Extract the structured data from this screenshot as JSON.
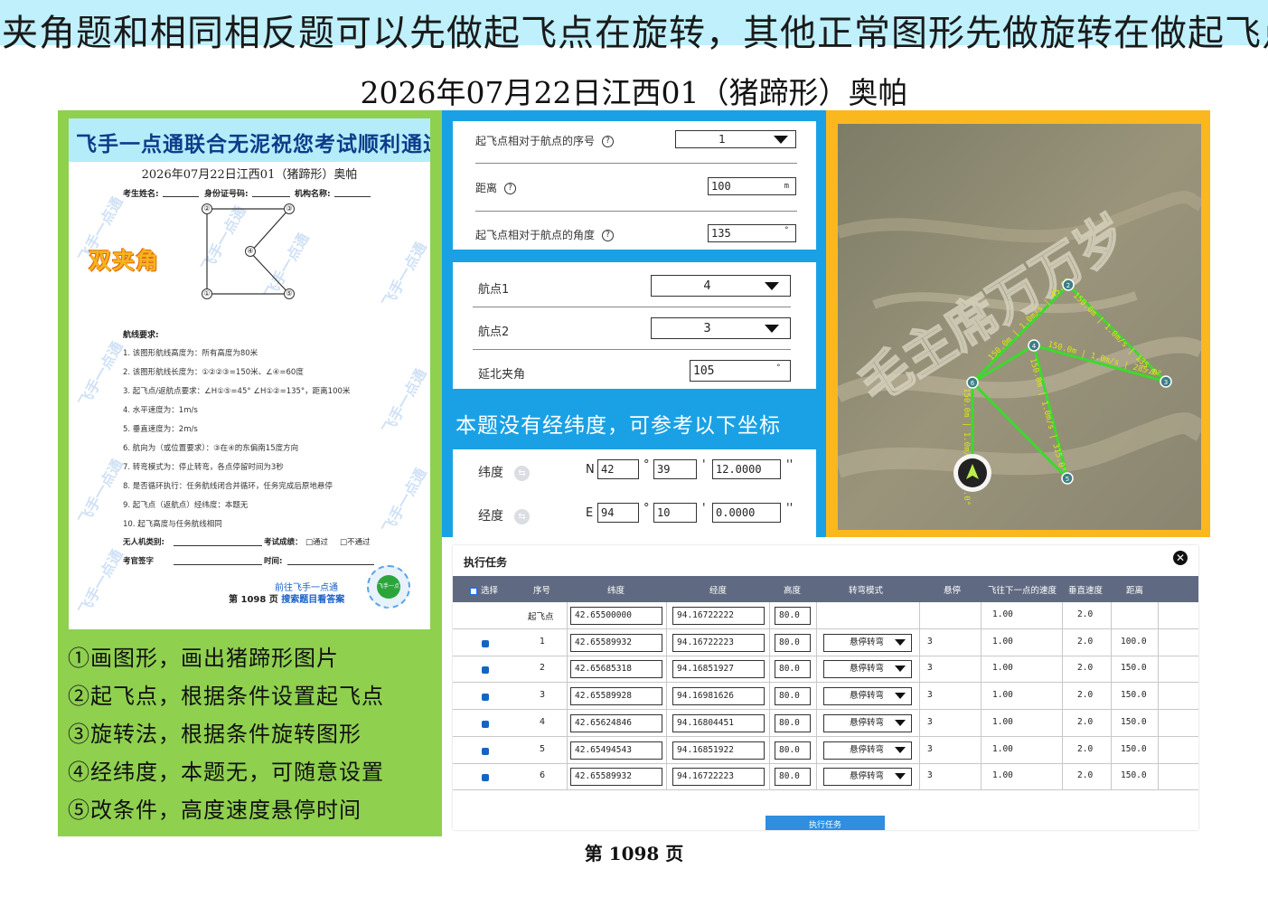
{
  "banner": "夹角题和相同相反题可以先做起飞点在旋转，其他正常图形先做旋转在做起飞点",
  "title": "2026年07月22日江西01（猪蹄形）奥帕",
  "paper": {
    "banner": "飞手一点通联合无泥祝您考试顺利通过",
    "title": "2026年07月22日江西01（猪蹄形）奥帕",
    "fields": [
      "考生姓名:",
      "身份证号码:",
      "机构名称:"
    ],
    "badge": "双夹角",
    "points": [
      "①",
      "②",
      "③",
      "④",
      "⑤"
    ],
    "requirements_head": "航线要求:",
    "requirements": [
      "1.  该图形航线高度为：所有高度为80米",
      "2.  该图形航线长度为：①②②③=150米、∠④=60度",
      "3.  起飞点/返航点要求：∠H①⑤=45°  ∠H①②=135°，距离100米",
      "4.  水平速度为：1m/s",
      "5.  垂直速度为：2m/s",
      "6.  航向为（或位置要求）：③在④的东偏南15度方向",
      "7.  转弯模式为：停止转弯，各点停留时间为3秒",
      "8.  是否循环执行：任务航线闭合并循环，任务完成后原地悬停",
      "9.  起飞点（返航点）经纬度：本题无",
      "10. 起飞高度与任务航线相同"
    ],
    "uav_type": "无人机类别:",
    "result": "考试成绩：",
    "pass": "□通过",
    "fail": "□不通过",
    "examiner": "考官签字",
    "time": "时间:",
    "foot1": "前往飞手一点通",
    "foot2_a": "第  1098  页",
    "foot2_b": "搜索题目看答案",
    "qr_text": "飞手一点通",
    "watermark": "飞手一点通"
  },
  "steps": [
    "①画图形，画出猪蹄形图片",
    "②起飞点，根据条件设置起飞点",
    "③旋转法，根据条件旋转图形",
    "④经纬度，本题无，可随意设置",
    "⑤改条件，高度速度悬停时间"
  ],
  "takeoff_form": {
    "seq_label": "起飞点相对于航点的序号",
    "seq_value": "1",
    "dist_label": "距离",
    "dist_value": "100",
    "dist_unit": "m",
    "angle_label": "起飞点相对于航点的角度",
    "angle_value": "135",
    "angle_unit": "°",
    "help": "?"
  },
  "angle_form": {
    "wp1_label": "航点1",
    "wp1_value": "4",
    "wp2_label": "航点2",
    "wp2_value": "3",
    "ext_label": "延北夹角",
    "ext_value": "105",
    "ext_unit": "°"
  },
  "ref_text": "本题没有经纬度，可参考以下坐标",
  "coords": {
    "lat_label": "纬度",
    "lat_dir": "N",
    "lat_deg": "42",
    "lat_min": "39",
    "lat_sec": "12.0000",
    "lon_label": "经度",
    "lon_dir": "E",
    "lon_deg": "94",
    "lon_min": "10",
    "lon_sec": "0.0000",
    "deg_sym": "°",
    "min_sym": "'",
    "sec_sym": "''"
  },
  "map": {
    "ground_text": "毛主席万万岁",
    "labels": [
      "150.0m | 1.0m/s | 45.0°",
      "150.0m | 1.0m/s | 135.0°",
      "150.0m | 1.0m/s | 315.0°",
      "150.0m | 1.0m/s | 225.0°",
      "150.0m | 1.0m/s | 285.0°"
    ],
    "wp_ids": [
      "2",
      "3",
      "4",
      "5",
      "6"
    ]
  },
  "task": {
    "title": "执行任务",
    "close": "✕",
    "headers": {
      "select": "选择",
      "seq": "序号",
      "lat": "纬度",
      "lon": "经度",
      "alt": "高度",
      "turn": "转弯模式",
      "hover": "悬停",
      "hspeed": "飞往下一点的速度",
      "vspeed": "垂直速度",
      "dist": "距离"
    },
    "rows": [
      {
        "seq": "起飞点",
        "lat": "42.65500000",
        "lon": "94.16722222",
        "alt": "80.0",
        "mode": "",
        "hover": "",
        "hspeed": "1.00",
        "vspeed": "2.0",
        "dist": ""
      },
      {
        "seq": "1",
        "lat": "42.65589932",
        "lon": "94.16722223",
        "alt": "80.0",
        "mode": "悬停转弯",
        "hover": "3",
        "hspeed": "1.00",
        "vspeed": "2.0",
        "dist": "100.0"
      },
      {
        "seq": "2",
        "lat": "42.65685318",
        "lon": "94.16851927",
        "alt": "80.0",
        "mode": "悬停转弯",
        "hover": "3",
        "hspeed": "1.00",
        "vspeed": "2.0",
        "dist": "150.0"
      },
      {
        "seq": "3",
        "lat": "42.65589928",
        "lon": "94.16981626",
        "alt": "80.0",
        "mode": "悬停转弯",
        "hover": "3",
        "hspeed": "1.00",
        "vspeed": "2.0",
        "dist": "150.0"
      },
      {
        "seq": "4",
        "lat": "42.65624846",
        "lon": "94.16804451",
        "alt": "80.0",
        "mode": "悬停转弯",
        "hover": "3",
        "hspeed": "1.00",
        "vspeed": "2.0",
        "dist": "150.0"
      },
      {
        "seq": "5",
        "lat": "42.65494543",
        "lon": "94.16851922",
        "alt": "80.0",
        "mode": "悬停转弯",
        "hover": "3",
        "hspeed": "1.00",
        "vspeed": "2.0",
        "dist": "150.0"
      },
      {
        "seq": "6",
        "lat": "42.65589932",
        "lon": "94.16722223",
        "alt": "80.0",
        "mode": "悬停转弯",
        "hover": "3",
        "hspeed": "1.00",
        "vspeed": "2.0",
        "dist": "150.0"
      }
    ],
    "exec_button": "执行任务"
  },
  "page_number": "第 1098 页",
  "colors": {
    "banner": "#bff0fb",
    "left_panel": "#8fd04f",
    "mid_panel": "#1aa1e5",
    "right_panel": "#fbb71e",
    "route": "#3adb2c",
    "table_header": "#5f6a82"
  }
}
